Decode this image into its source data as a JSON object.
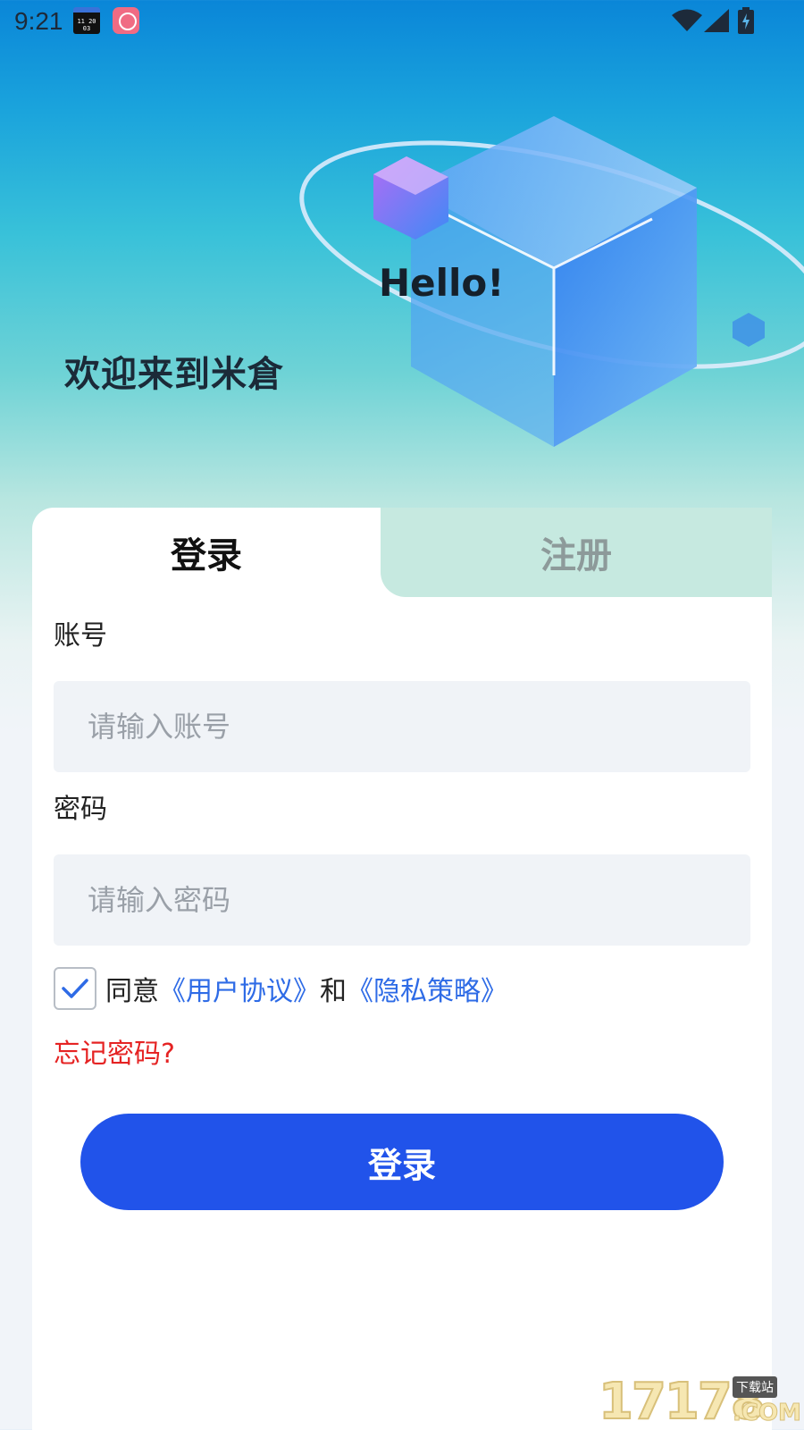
{
  "status_bar": {
    "time": "9:21",
    "app1_mini_text": "11 20 03"
  },
  "hero": {
    "hello": "Hello!",
    "welcome": "欢迎来到米倉"
  },
  "tabs": {
    "login_label": "登录",
    "register_label": "注册",
    "active": "login"
  },
  "form": {
    "account_label": "账号",
    "account_placeholder": "请输入账号",
    "account_value": "",
    "password_label": "密码",
    "password_placeholder": "请输入密码",
    "password_value": "",
    "agree_checked": true,
    "agree_prefix": "同意",
    "user_agreement_link": "《用户协议》",
    "agree_and": "和",
    "privacy_policy_link": "《隐私策略》",
    "forgot_password": "忘记密码?",
    "submit_label": "登录"
  },
  "watermark": {
    "digits": "17178",
    "tag": "下载站",
    "suffix": ".COM"
  },
  "colors": {
    "primary_button": "#2153ea",
    "link": "#2e6be6",
    "forgot": "#e52323",
    "input_bg": "#f0f3f7",
    "inactive_tab_bg": "#c6e9e0"
  }
}
